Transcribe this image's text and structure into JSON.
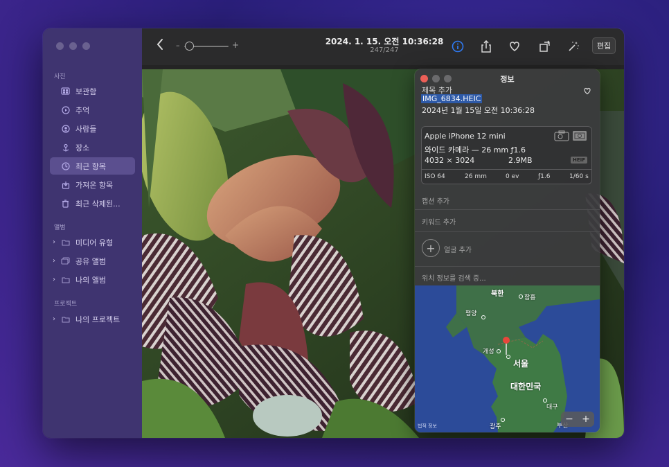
{
  "sidebar": {
    "sections": [
      {
        "label": "사진"
      },
      {
        "label": "앨범"
      },
      {
        "label": "프로젝트"
      }
    ],
    "items": [
      {
        "label": "보관함",
        "icon": "photos-library-icon"
      },
      {
        "label": "추억",
        "icon": "memories-icon"
      },
      {
        "label": "사람들",
        "icon": "people-icon"
      },
      {
        "label": "장소",
        "icon": "places-icon"
      },
      {
        "label": "최근 항목",
        "icon": "recents-icon",
        "selected": true
      },
      {
        "label": "가져온 항목",
        "icon": "imports-icon"
      },
      {
        "label": "최근 삭제된...",
        "icon": "trash-icon"
      },
      {
        "label": "미디어 유형",
        "icon": "folder-icon"
      },
      {
        "label": "공유 앨범",
        "icon": "shared-album-icon"
      },
      {
        "label": "나의 앨범",
        "icon": "folder-icon"
      },
      {
        "label": "나의 프로젝트",
        "icon": "folder-icon"
      }
    ]
  },
  "toolbar": {
    "title": "2024. 1. 15. 오전 10:36:28",
    "subtitle": "247/247",
    "zoom_minus": "–",
    "zoom_plus": "+",
    "edit_label": "편집"
  },
  "info": {
    "window_title": "정보",
    "add_title": "제목 추가",
    "filename": "IMG_6834.HEIC",
    "date": "2024년 1월 15일   오전 10:36:28",
    "device": "Apple iPhone 12 mini",
    "lens": "와이드 카메라 — 26 mm ƒ1.6",
    "resolution": "4032 × 3024",
    "file_size": "2.9MB",
    "format_badge": "HEIF",
    "exif": {
      "iso": "ISO 64",
      "focal": "26 mm",
      "ev": "0 ev",
      "aperture": "ƒ1.6",
      "shutter": "1/60 s"
    },
    "caption_placeholder": "캡션 추가",
    "keyword_placeholder": "키워드 추가",
    "add_face": "얼굴 추가",
    "location_status": "위치 정보를 검색 중...",
    "map": {
      "legal": "법적 정보",
      "labels": {
        "north_korea": "북한",
        "hamhung": "함흥",
        "pyongyang": "평양",
        "kaesong": "개성",
        "seoul": "서울",
        "south_korea": "대한민국",
        "daegu": "대구",
        "gwangju": "광주",
        "busan": "부산"
      }
    }
  },
  "colors": {
    "sidebar_bg": "#3f3470",
    "selected_bg": "#5b4f8f",
    "accent_info": "#2f7bf5",
    "close_red": "#ec5f57",
    "filename_highlight": "#2e5aa8",
    "map_pin": "#e8463b"
  }
}
